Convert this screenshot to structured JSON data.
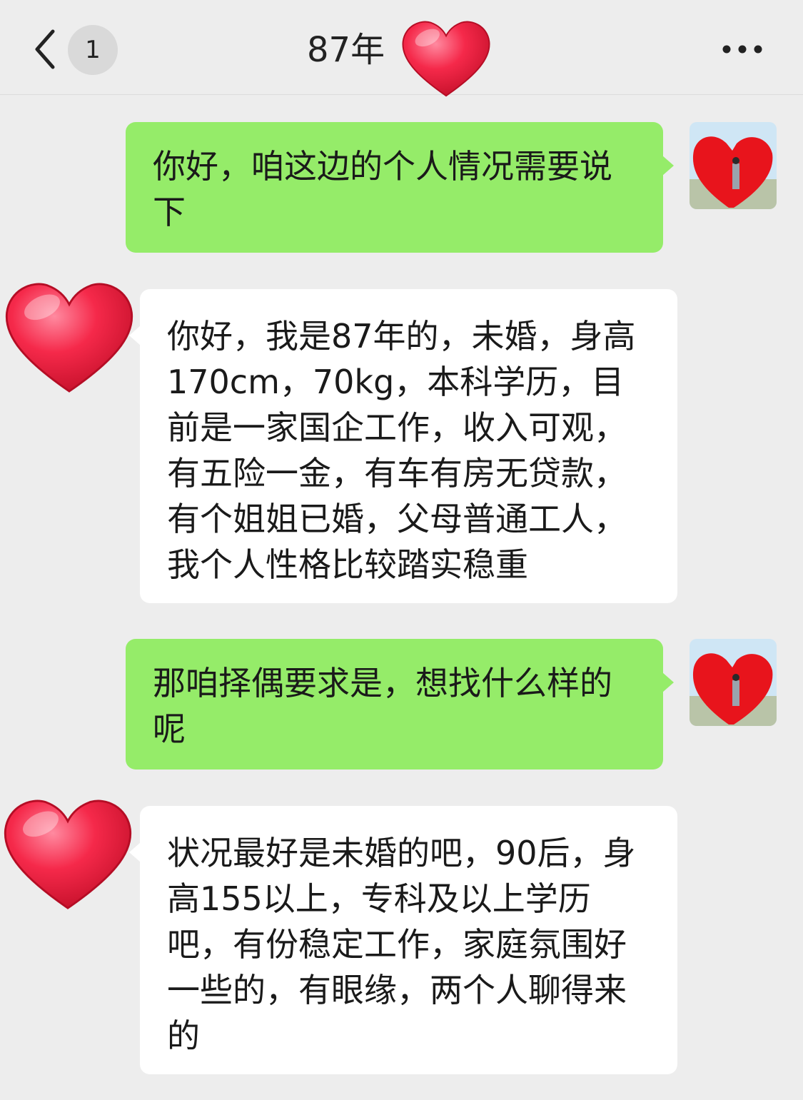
{
  "header": {
    "unread_count": "1",
    "title": "87年"
  },
  "messages": [
    {
      "side": "out",
      "text": "你好，咱这边的个人情况需要说下"
    },
    {
      "side": "in",
      "text": "你好，我是87年的，未婚，身高170cm，70kg，本科学历，目前是一家国企工作，收入可观，有五险一金，有车有房无贷款，有个姐姐已婚，父母普通工人，我个人性格比较踏实稳重"
    },
    {
      "side": "out",
      "text": "那咱择偶要求是，想找什么样的呢"
    },
    {
      "side": "in",
      "text": "状况最好是未婚的吧，90后，身高155以上，专科及以上学历吧，有份稳定工作，家庭氛围好一些的，有眼缘，两个人聊得来的"
    }
  ],
  "colors": {
    "background": "#ededed",
    "outgoing_bubble": "#95ec69",
    "incoming_bubble": "#ffffff",
    "heart": "#f0203a"
  },
  "icons": {
    "back": "chevron-left-icon",
    "more": "more-dots-icon",
    "privacy_cover": "heart-sticker-icon"
  }
}
